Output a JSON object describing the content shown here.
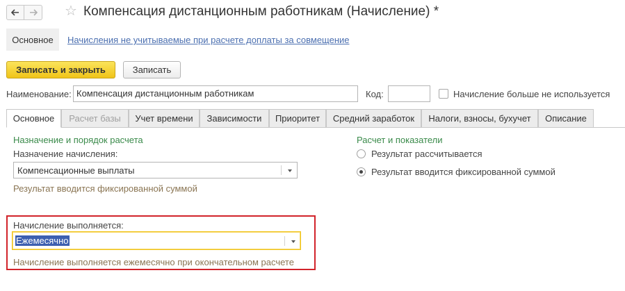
{
  "window": {
    "title": "Компенсация дистанционным работникам (Начисление) *"
  },
  "sections": {
    "main": "Основное",
    "link": "Начисления не учитываемые при расчете доплаты за совмещение"
  },
  "toolbar": {
    "save_close": "Записать и закрыть",
    "save": "Записать"
  },
  "header_fields": {
    "name_label": "Наименование:",
    "name_value": "Компенсация дистанционным работникам",
    "code_label": "Код:",
    "code_value": "",
    "not_used_label": "Начисление больше не используется",
    "not_used_checked": false
  },
  "tabs": [
    {
      "label": "Основное",
      "active": true,
      "disabled": false
    },
    {
      "label": "Расчет базы",
      "active": false,
      "disabled": true
    },
    {
      "label": "Учет времени",
      "active": false,
      "disabled": false
    },
    {
      "label": "Зависимости",
      "active": false,
      "disabled": false
    },
    {
      "label": "Приоритет",
      "active": false,
      "disabled": false
    },
    {
      "label": "Средний заработок",
      "active": false,
      "disabled": false
    },
    {
      "label": "Налоги, взносы, бухучет",
      "active": false,
      "disabled": false
    },
    {
      "label": "Описание",
      "active": false,
      "disabled": false
    }
  ],
  "purpose_group": {
    "title": "Назначение и порядок расчета",
    "purpose_label": "Назначение начисления:",
    "purpose_value": "Компенсационные выплаты",
    "purpose_hint": "Результат вводится фиксированной суммой"
  },
  "calc_group": {
    "title": "Расчет и показатели",
    "options": [
      {
        "label": "Результат рассчитывается",
        "selected": false
      },
      {
        "label": "Результат вводится фиксированной суммой",
        "selected": true
      }
    ]
  },
  "execution": {
    "label": "Начисление выполняется:",
    "value": "Ежемесячно",
    "hint": "Начисление выполняется ежемесячно при окончательном расчете"
  },
  "colors": {
    "accent_yellow": "#f0c419",
    "group_title_green": "#3a8a4a",
    "hint_brown": "#8a7553",
    "highlight_red": "#d2232a",
    "link_blue": "#4b6fb0"
  }
}
